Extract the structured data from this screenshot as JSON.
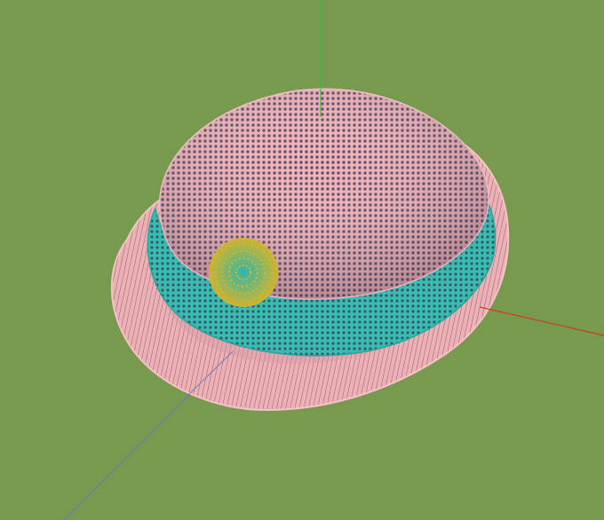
{
  "viewport": {
    "background": "#789a4e"
  },
  "axes": {
    "x_color": "#d23a1c",
    "y_color": "#3fb83a",
    "z_color": "#6d7bb4"
  },
  "hat": {
    "style": "bowler / bell hat rendered as point-cloud wireframe",
    "shell_color": "#f0b0b4",
    "shell_dot_color": "#5a4a66",
    "band_color": "#34b8ad",
    "band_dot_color": "#3f5a73",
    "button_color": "#35b8a6",
    "button_dot_color": "#d4b22e"
  }
}
